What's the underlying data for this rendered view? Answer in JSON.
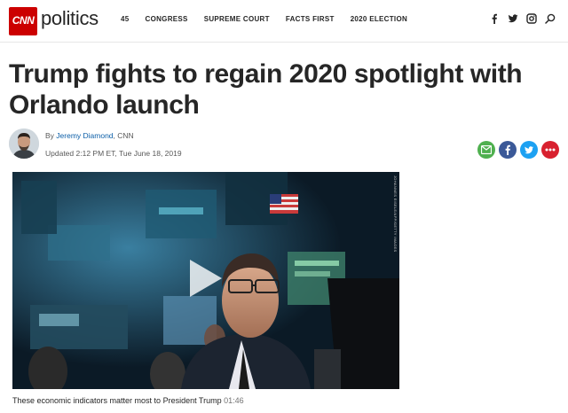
{
  "header": {
    "logo_text": "CNN",
    "section": "politics",
    "nav": [
      "45",
      "CONGRESS",
      "SUPREME COURT",
      "FACTS FIRST",
      "2020 ELECTION"
    ],
    "social_icons": [
      "facebook-icon",
      "twitter-icon",
      "instagram-icon",
      "search-icon"
    ],
    "brand_color": "#cc0000"
  },
  "article": {
    "headline": "Trump fights to regain 2020 spotlight with Orlando launch",
    "byline_prefix": "By ",
    "author": "Jeremy Diamond",
    "byline_suffix": ", CNN",
    "updated": "Updated 2:12 PM ET, Tue June 18, 2019"
  },
  "share": [
    {
      "name": "email-share",
      "color": "#4fb04f"
    },
    {
      "name": "facebook-share",
      "color": "#3b5998"
    },
    {
      "name": "twitter-share",
      "color": "#1da1f2"
    },
    {
      "name": "more-share",
      "color": "#d8212f"
    }
  ],
  "video": {
    "caption": "These economic indicators matter most to President Trump",
    "duration": "01:46",
    "credit": "JOHANNES EISELE/AFP/GETTY IMAGES"
  }
}
